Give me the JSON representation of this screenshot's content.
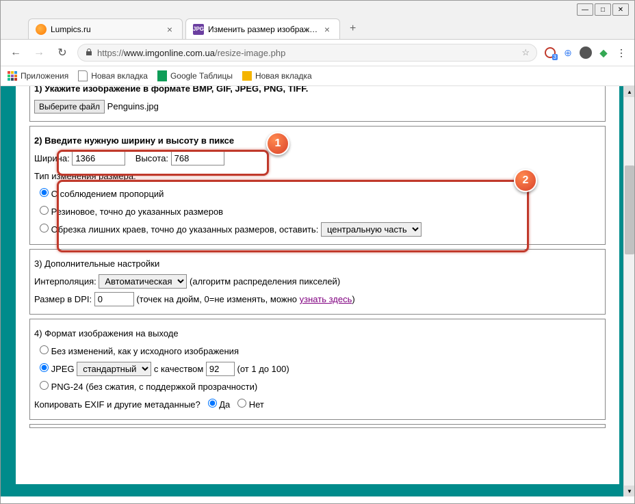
{
  "window": {
    "min": "—",
    "max": "□",
    "close": "✕"
  },
  "tabs": [
    {
      "title": "Lumpics.ru"
    },
    {
      "title": "Изменить размер изображения",
      "icon_label": "JPG"
    }
  ],
  "new_tab": "+",
  "nav": {
    "back": "←",
    "forward": "→",
    "reload": "↻"
  },
  "addr": {
    "url_prefix": "https://",
    "url_domain": "www.imgonline.com.ua",
    "url_path": "/resize-image.php",
    "star": "☆"
  },
  "ext": {
    "badge": "3",
    "globe": "⊕",
    "menu": "⋮"
  },
  "bookmarks": {
    "apps": "Приложения",
    "newtab1": "Новая вкладка",
    "sheets": "Google Таблицы",
    "newtab2": "Новая вкладка"
  },
  "section1": {
    "heading": "1) Укажите изображение в формате BMP, GIF, JPEG, PNG, TIFF.",
    "choose_file": "Выберите файл",
    "filename": "Penguins.jpg"
  },
  "section2": {
    "heading": "2) Введите нужную ширину и высоту в пиксе",
    "width_label": "Ширина:",
    "width_value": "1366",
    "height_label": "Высота:",
    "height_value": "768",
    "resize_type_label": "Тип изменения размера:",
    "opt1": "С соблюдением пропорций",
    "opt2": "Резиновое, точно до указанных размеров",
    "opt3": "Обрезка лишних краев, точно до указанных размеров, оставить:",
    "crop_select": "центральную часть"
  },
  "section3": {
    "heading": "3) Дополнительные настройки",
    "interp_label": "Интерполяция:",
    "interp_value": "Автоматическая",
    "interp_hint": "(алгоритм распределения пикселей)",
    "dpi_label": "Размер в DPI:",
    "dpi_value": "0",
    "dpi_hint_pre": "(точек на дюйм, 0=не изменять, можно ",
    "dpi_link": "узнать здесь",
    "dpi_hint_post": ")"
  },
  "section4": {
    "heading": "4) Формат изображения на выходе",
    "opt1": "Без изменений, как у исходного изображения",
    "opt2_pre": "JPEG",
    "opt2_select": "стандартный",
    "opt2_mid": "с качеством",
    "opt2_val": "92",
    "opt2_post": "(от 1 до 100)",
    "opt3": "PNG-24 (без сжатия, с поддержкой прозрачности)",
    "exif_label": "Копировать EXIF и другие метаданные?",
    "yes": "Да",
    "no": "Нет"
  },
  "badges": {
    "b1": "1",
    "b2": "2"
  }
}
